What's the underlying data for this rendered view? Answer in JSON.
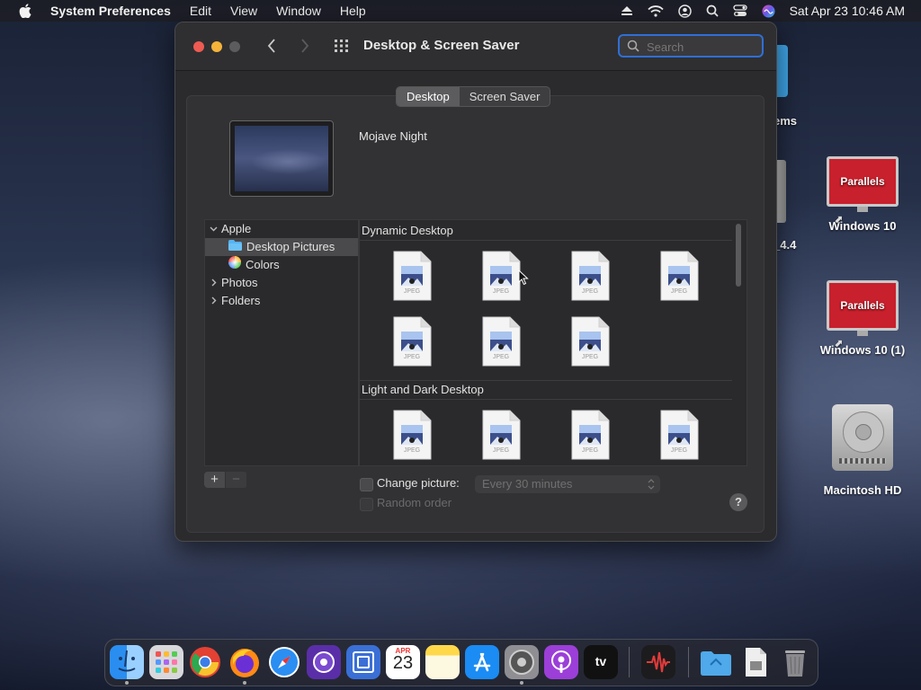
{
  "menubar": {
    "app_name": "System Preferences",
    "menus": [
      "Edit",
      "View",
      "Window",
      "Help"
    ],
    "clock": "Sat Apr 23  10:46 AM",
    "status_icons": [
      "eject-icon",
      "wifi-icon",
      "user-icon",
      "spotlight-icon",
      "control-center-icon",
      "siri-icon"
    ]
  },
  "desktop": {
    "items": [
      {
        "label": "ems"
      },
      {
        "label": "_4.4"
      },
      {
        "label": "Windows 10",
        "badge": "Parallels"
      },
      {
        "label": "Windows 10 (1)",
        "badge": "Parallels"
      },
      {
        "label": "Macintosh HD"
      }
    ]
  },
  "window": {
    "title": "Desktop & Screen Saver",
    "search_placeholder": "Search",
    "tabs": [
      {
        "label": "Desktop",
        "active": true
      },
      {
        "label": "Screen Saver",
        "active": false
      }
    ],
    "preview_name": "Mojave Night",
    "sidebar": [
      {
        "label": "Apple",
        "expanded": true,
        "level": 0
      },
      {
        "label": "Desktop Pictures",
        "selected": true,
        "level": 1,
        "icon": "folder-icon"
      },
      {
        "label": "Colors",
        "level": 1,
        "icon": "color-wheel-icon"
      },
      {
        "label": "Photos",
        "expanded": false,
        "level": 0
      },
      {
        "label": "Folders",
        "expanded": false,
        "level": 0
      }
    ],
    "sections": [
      {
        "title": "Dynamic Desktop",
        "file_count": 7
      },
      {
        "title": "Light and Dark Desktop",
        "file_count": 4
      }
    ],
    "file_type_label": "JPEG",
    "add_label": "+",
    "remove_label": "−",
    "change_picture_label": "Change picture:",
    "change_picture_checked": false,
    "interval_value": "Every 30 minutes",
    "random_order_label": "Random order",
    "random_order_enabled": false,
    "help_label": "?"
  },
  "dock": {
    "apps": [
      "Finder",
      "Launchpad",
      "Google Chrome",
      "Firefox",
      "Safari",
      "Screenshot",
      "Remote Desktop",
      "Calendar",
      "Notes",
      "App Store",
      "System Preferences",
      "Podcasts",
      "Apple TV",
      "Audio Recorder",
      "Downloads",
      "Document",
      "Trash"
    ],
    "calendar_month": "APR",
    "calendar_day": "23",
    "tv_label": "tv"
  },
  "colors": {
    "accent": "#2f6fd6",
    "close": "#ee5b52",
    "minimize": "#f5b33a",
    "zoom": "#5c5c5e"
  }
}
